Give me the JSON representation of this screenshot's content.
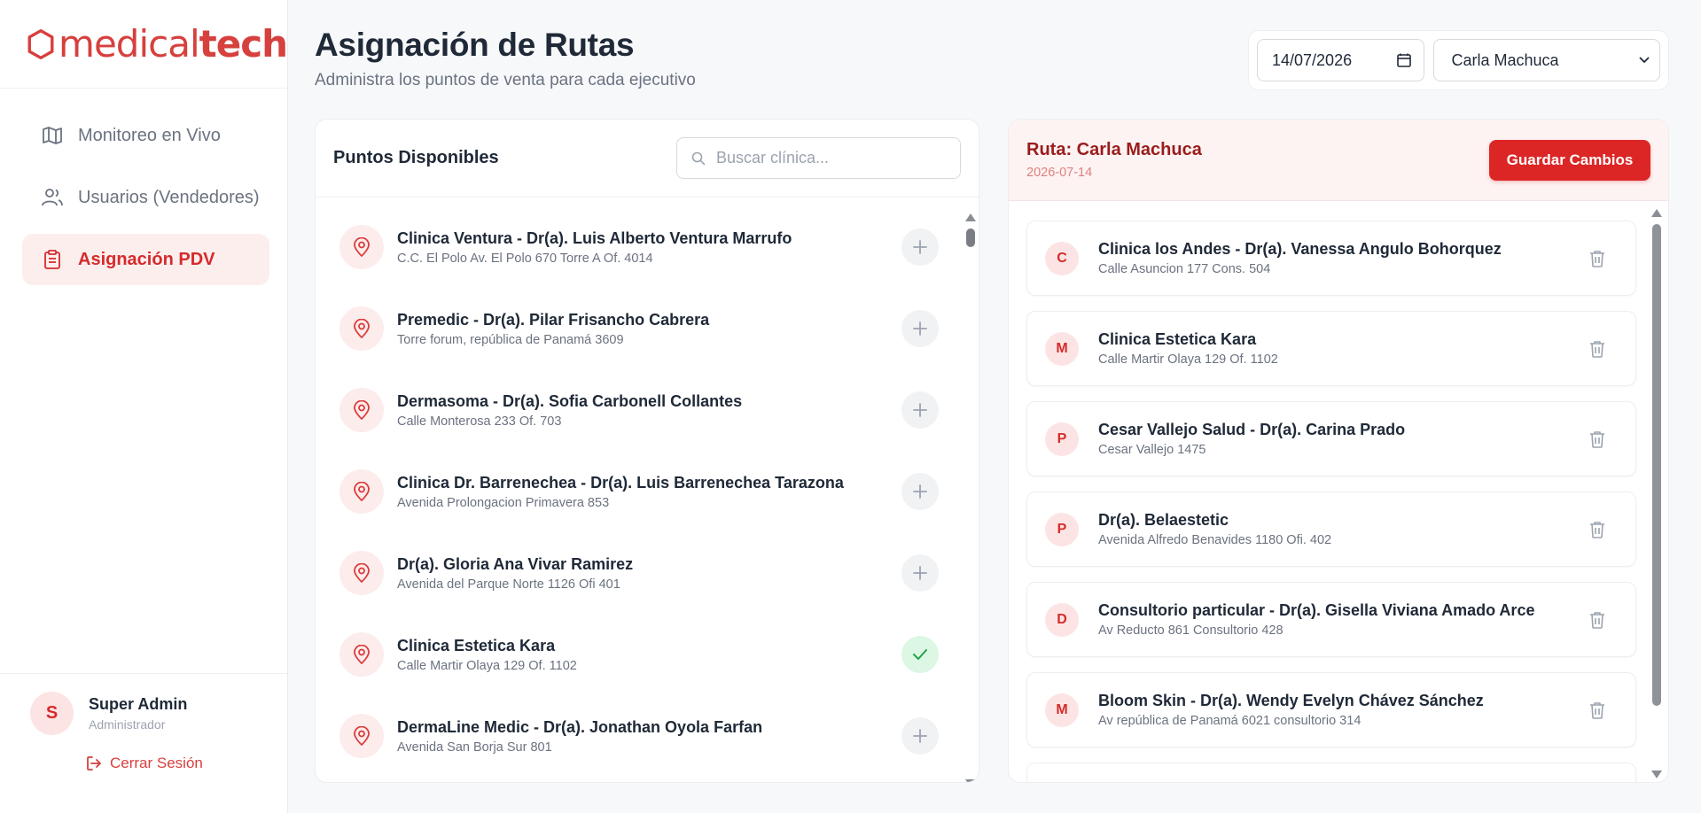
{
  "brand": {
    "name_light": "medical",
    "name_bold": "tech",
    "accent": "#d6403d"
  },
  "sidebar": {
    "items": [
      {
        "label": "Monitoreo en Vivo",
        "icon": "map-icon"
      },
      {
        "label": "Usuarios (Vendedores)",
        "icon": "users-icon"
      },
      {
        "label": "Asignación PDV",
        "icon": "clipboard-icon",
        "active": true
      }
    ],
    "user": {
      "initial": "S",
      "name": "Super Admin",
      "role": "Administrador"
    },
    "logout_label": "Cerrar Sesión"
  },
  "header": {
    "title": "Asignación de Rutas",
    "subtitle": "Administra los puntos de venta para cada ejecutivo",
    "date_value": "14/07/2026",
    "executive_selected": "Carla Machuca"
  },
  "available": {
    "title": "Puntos Disponibles",
    "search_placeholder": "Buscar clínica...",
    "items": [
      {
        "name": "Clinica Ventura - Dr(a). Luis Alberto Ventura Marrufo",
        "address": "C.C. El Polo Av. El Polo 670 Torre A Of. 4014",
        "assigned": false
      },
      {
        "name": "Premedic - Dr(a). Pilar Frisancho Cabrera",
        "address": "Torre forum, república de Panamá 3609",
        "assigned": false
      },
      {
        "name": "Dermasoma - Dr(a). Sofia Carbonell Collantes",
        "address": "Calle Monterosa 233 Of. 703",
        "assigned": false
      },
      {
        "name": "Clinica Dr. Barrenechea - Dr(a). Luis Barrenechea Tarazona",
        "address": "Avenida Prolongacion Primavera 853",
        "assigned": false
      },
      {
        "name": "Dr(a). Gloria Ana Vivar Ramirez",
        "address": "Avenida del Parque Norte 1126 Ofi 401",
        "assigned": false
      },
      {
        "name": "Clinica Estetica Kara",
        "address": "Calle Martir Olaya 129 Of. 1102",
        "assigned": true
      },
      {
        "name": "DermaLine Medic - Dr(a). Jonathan Oyola Farfan",
        "address": "Avenida San Borja Sur 801",
        "assigned": false
      }
    ]
  },
  "route": {
    "title": "Ruta: Carla Machuca",
    "date": "2026-07-14",
    "save_label": "Guardar Cambios",
    "items": [
      {
        "initial": "C",
        "name": "Clinica los Andes - Dr(a). Vanessa Angulo Bohorquez",
        "address": "Calle Asuncion 177 Cons. 504"
      },
      {
        "initial": "M",
        "name": "Clinica Estetica Kara",
        "address": "Calle Martir Olaya 129 Of. 1102"
      },
      {
        "initial": "P",
        "name": "Cesar Vallejo Salud - Dr(a). Carina Prado",
        "address": "Cesar Vallejo 1475"
      },
      {
        "initial": "P",
        "name": "Dr(a). Belaestetic",
        "address": "Avenida Alfredo Benavides 1180 Ofi. 402"
      },
      {
        "initial": "D",
        "name": "Consultorio particular - Dr(a). Gisella Viviana Amado Arce",
        "address": "Av Reducto 861 Consultorio 428"
      },
      {
        "initial": "M",
        "name": "Bloom Skin - Dr(a). Wendy Evelyn Chávez Sánchez",
        "address": "Av república de Panamá 6021 consultorio 314"
      }
    ]
  }
}
